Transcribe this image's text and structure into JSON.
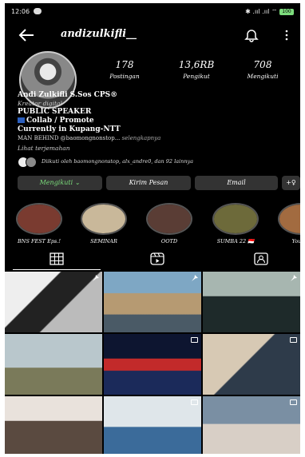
{
  "status_bar": {
    "time": "12:06",
    "icons": "✱ .ııl .ııl ⌔",
    "battery": "100"
  },
  "profile": {
    "username": "andizulkifli__",
    "posts_count": "178",
    "posts_label": "Postingan",
    "followers_count": "13,6RB",
    "followers_label": "Pengikut",
    "following_count": "708",
    "following_label": "Mengikuti"
  },
  "bio": {
    "name": "Andi Zulkifli S.Sos CPS®",
    "category": "Kreator digital",
    "line1": "PUBLIC SPEAKER",
    "line2": "Collab / Promote",
    "line3": "Currently in Kupang-NTT",
    "line4_prefix": "MAN BEHIND ",
    "line4_handle": "@baomongnonstop...",
    "line4_more": " selengkapnya",
    "translate": "Lihat terjemahan"
  },
  "followed_by": "Diikuti oleh baomongnonstop, alx_andre0, dan 92 lainnya",
  "buttons": {
    "follow": "Mengikuti ⌄",
    "message": "Kirim Pesan",
    "email": "Email",
    "add_user": "+♀"
  },
  "highlights": [
    {
      "label": "BNS FEST Eps.!",
      "color": "#7a3b30"
    },
    {
      "label": "SEMINAR",
      "color": "#c9b89a"
    },
    {
      "label": "OOTD",
      "color": "#5a3d35"
    },
    {
      "label": "SUMBA 22 🇮🇩",
      "color": "#6d6a3a"
    },
    {
      "label": "Youtub",
      "color": "#a26b40"
    }
  ],
  "tabs": [
    "grid-tab",
    "reels-tab",
    "tagged-tab"
  ],
  "grid": [
    {
      "bg": "linear-gradient(135deg,#eee 0 35%,#222 36% 60%,#bbb 61%)",
      "badge": "pin"
    },
    {
      "bg": "linear-gradient(180deg,#7ea7c4 0 35%,#b69a72 36% 70%,#4a5a66 71%)",
      "badge": "pin"
    },
    {
      "bg": "linear-gradient(180deg,#a7b6b0 0 40%,#1e2a2a 41%)",
      "badge": "pin"
    },
    {
      "bg": "linear-gradient(180deg,#b9c7cc 0 55%,#7a7a5a 56%)",
      "badge": "none"
    },
    {
      "bg": "linear-gradient(180deg,#0d1530 0 40%,#c22a2a 41% 60%,#1b2a5a 61%)",
      "badge": "multi"
    },
    {
      "bg": "linear-gradient(135deg,#d7c9b4 0 45%,#2e3b4a 46%)",
      "badge": "multi"
    },
    {
      "bg": "linear-gradient(180deg,#e9e2dc 0 40%,#5a4a40 41%)",
      "badge": "none"
    },
    {
      "bg": "linear-gradient(180deg,#dfe6ea 0 50%,#3b6b9a 51%)",
      "badge": "multi"
    },
    {
      "bg": "linear-gradient(180deg,#7a8fa3 0 45%,#d8cfc6 46%)",
      "badge": "multi"
    }
  ]
}
